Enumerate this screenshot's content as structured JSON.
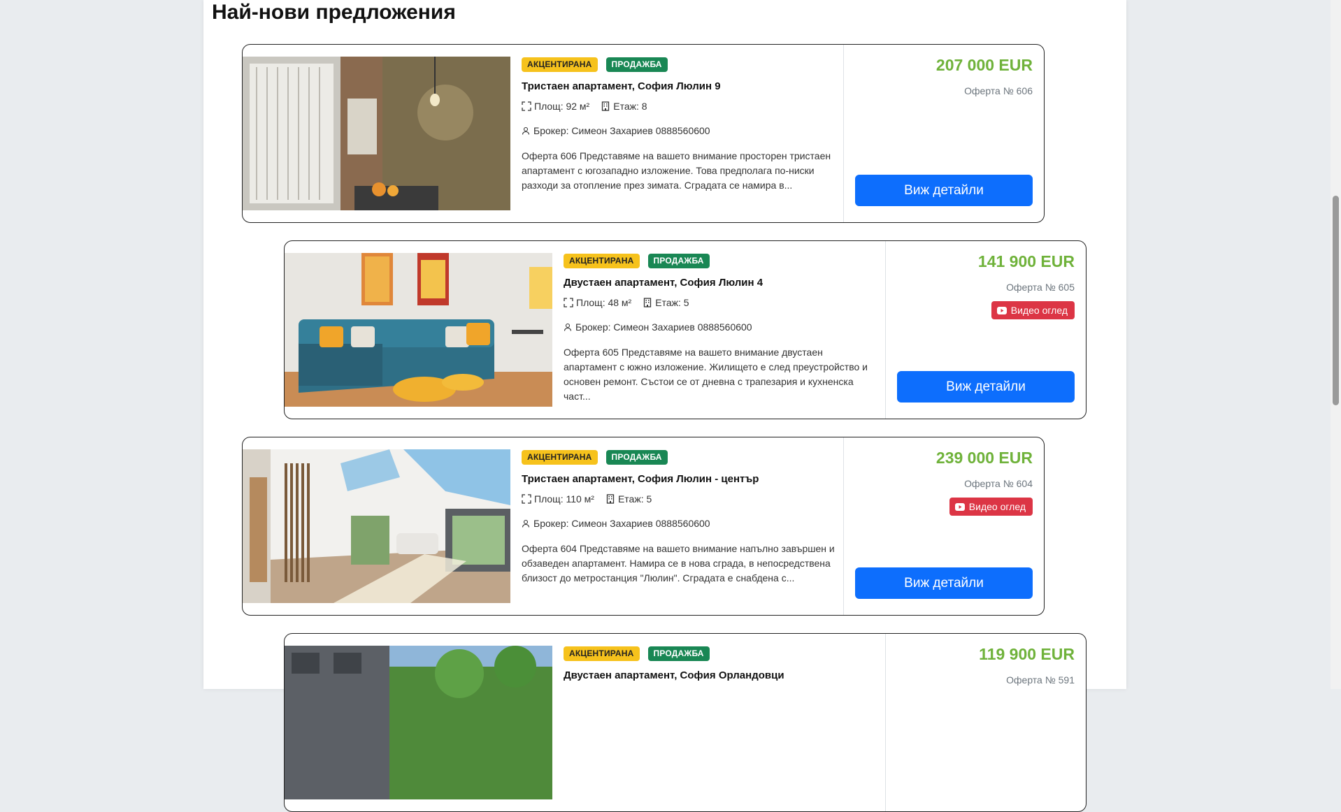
{
  "section_title": "Най-нови предложения",
  "listings": [
    {
      "badge_accent": "АКЦЕНТИРАНА",
      "badge_sale": "ПРОДАЖБА",
      "title": "Тристаен апартамент, София Люлин 9",
      "area": "Площ: 92 м²",
      "floor": "Етаж: 8",
      "broker": "Брокер: Симеон Захариев 0888560600",
      "description": "Оферта 606 Представяме на вашето внимание просторен тристаен апартамент с югозападно изложение. Това предполага по-ниски разходи за отопление през зимата. Сградата се намира в...",
      "price": "207 000 EUR",
      "offer": "Оферта № 606",
      "details_label": "Виж детайли"
    },
    {
      "badge_accent": "АКЦЕНТИРАНА",
      "badge_sale": "ПРОДАЖБА",
      "title": "Двустаен апартамент, София Люлин 4",
      "area": "Площ: 48 м²",
      "floor": "Етаж: 5",
      "broker": "Брокер: Симеон Захариев 0888560600",
      "description": "Оферта 605 Представяме на вашето внимание двустаен апартамент с южно изложение. Жилището е след преустройство и основен ремонт. Състои се от дневна с трапезария и кухненска част...",
      "price": "141 900 EUR",
      "offer": "Оферта № 605",
      "video_label": "Видео оглед",
      "details_label": "Виж детайли"
    },
    {
      "badge_accent": "АКЦЕНТИРАНА",
      "badge_sale": "ПРОДАЖБА",
      "title": "Тристаен апартамент, София Люлин - център",
      "area": "Площ: 110 м²",
      "floor": "Етаж: 5",
      "broker": "Брокер: Симеон Захариев 0888560600",
      "description": "Оферта 604 Представяме на вашето внимание напълно завършен и обзаведен апартамент. Намира се в нова сграда, в непосредствена близост до метростанция \"Люлин\". Сградата е снабдена с...",
      "price": "239 000 EUR",
      "offer": "Оферта № 604",
      "video_label": "Видео оглед",
      "details_label": "Виж детайли"
    },
    {
      "badge_accent": "АКЦЕНТИРАНА",
      "badge_sale": "ПРОДАЖБА",
      "title": "Двустаен апартамент, София Орландовци",
      "price": "119 900 EUR",
      "offer": "Оферта № 591"
    }
  ],
  "colors": {
    "price": "#6fb23a",
    "accent_badge": "#f6c21c",
    "sale_badge": "#198754",
    "primary_button": "#0d6efd",
    "video_button": "#dc3545"
  }
}
